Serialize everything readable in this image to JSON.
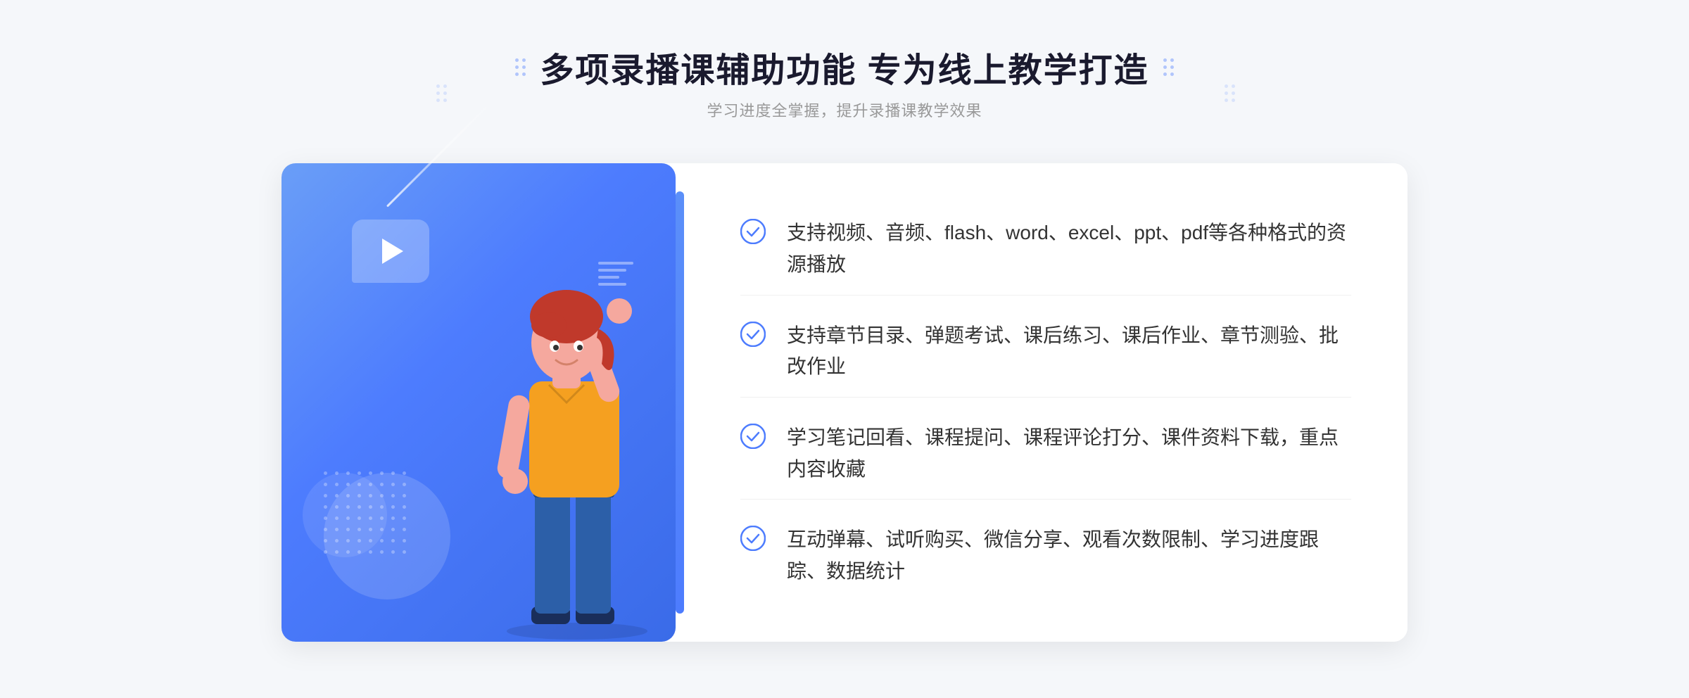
{
  "header": {
    "title": "多项录播课辅助功能 专为线上教学打造",
    "subtitle": "学习进度全掌握，提升录播课教学效果"
  },
  "features": [
    {
      "id": "feature-1",
      "text": "支持视频、音频、flash、word、excel、ppt、pdf等各种格式的资源播放"
    },
    {
      "id": "feature-2",
      "text": "支持章节目录、弹题考试、课后练习、课后作业、章节测验、批改作业"
    },
    {
      "id": "feature-3",
      "text": "学习笔记回看、课程提问、课程评论打分、课件资料下载，重点内容收藏"
    },
    {
      "id": "feature-4",
      "text": "互动弹幕、试听购买、微信分享、观看次数限制、学习进度跟踪、数据统计"
    }
  ],
  "decorative": {
    "dots_label": "decorative dots",
    "chevron_symbol": "»"
  }
}
